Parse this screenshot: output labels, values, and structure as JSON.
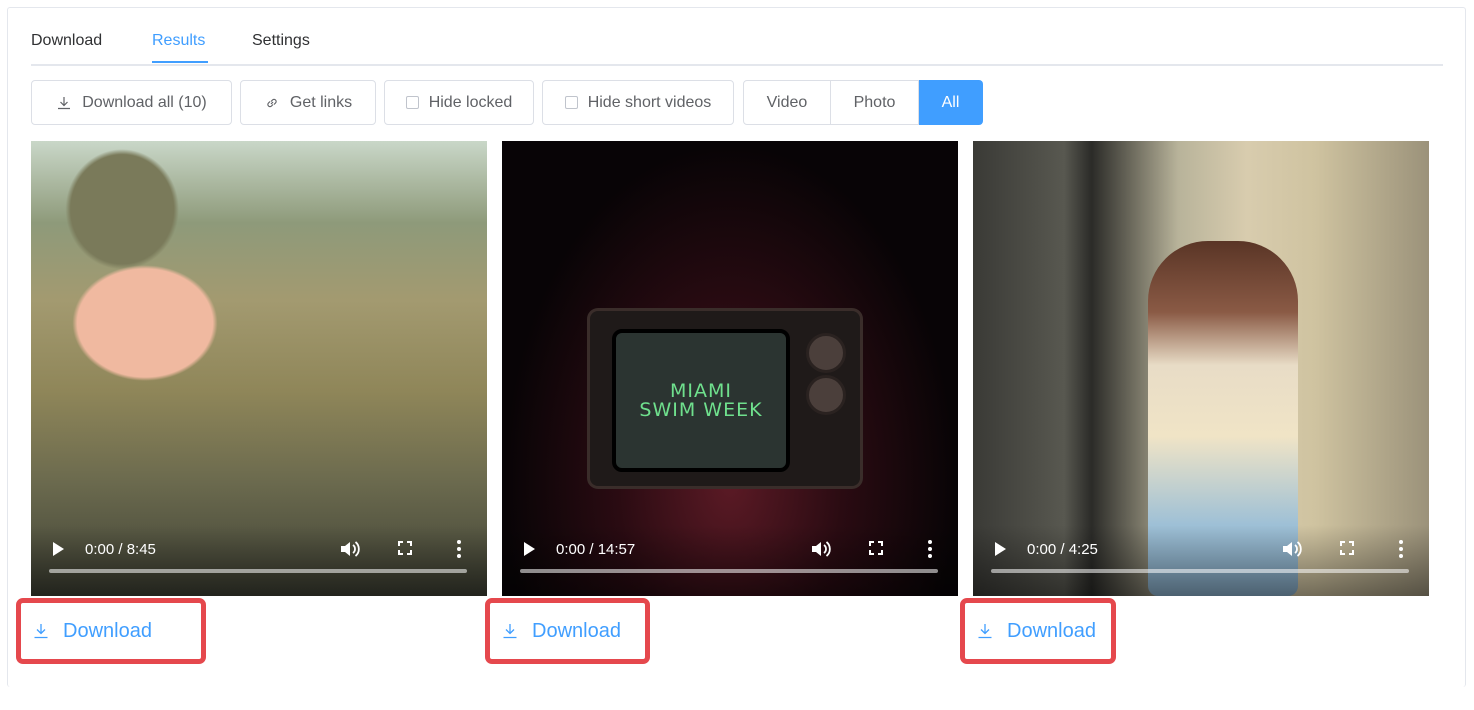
{
  "tabs": [
    {
      "label": "Download"
    },
    {
      "label": "Results"
    },
    {
      "label": "Settings"
    }
  ],
  "active_tab": "Results",
  "toolbar": {
    "download_all_label": "Download all (10)",
    "get_links_label": "Get links",
    "hide_locked_label": "Hide locked",
    "hide_short_label": "Hide short videos",
    "filter": {
      "options": [
        "Video",
        "Photo",
        "All"
      ],
      "selected": "All"
    }
  },
  "results": [
    {
      "time": "0:00 / 8:45",
      "download_label": "Download"
    },
    {
      "time": "0:00 / 14:57",
      "download_label": "Download",
      "overlay_text_1": "MIAMI",
      "overlay_text_2": "SWIM WEEK"
    },
    {
      "time": "0:00 / 4:25",
      "download_label": "Download"
    }
  ],
  "colors": {
    "accent": "#409eff",
    "highlight": "#e5484d"
  },
  "icons": {
    "download": "download-icon",
    "link": "link-icon",
    "play": "play-icon",
    "volume": "volume-icon",
    "fullscreen": "fullscreen-icon",
    "more": "more-vertical-icon"
  }
}
